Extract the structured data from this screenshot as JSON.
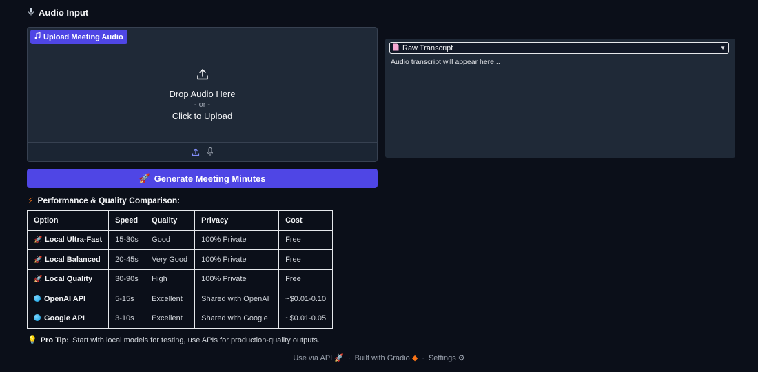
{
  "header": {
    "title": "Audio Input",
    "icon": "microphone-icon"
  },
  "upload": {
    "label": "Upload Meeting Audio",
    "label_icon": "music-note-icon",
    "drop_text": "Drop Audio Here",
    "or_text": "- or -",
    "click_text": "Click to Upload",
    "sources": [
      "upload-icon",
      "microphone-icon"
    ]
  },
  "generate_button": {
    "label": "Generate Meeting Minutes",
    "icon": "rocket-icon"
  },
  "comparison": {
    "heading": "Performance & Quality Comparison:",
    "heading_icon": "lightning-icon",
    "columns": [
      "Option",
      "Speed",
      "Quality",
      "Privacy",
      "Cost"
    ],
    "rows": [
      {
        "icon": "rocket-icon",
        "option": "Local Ultra-Fast",
        "speed": "15-30s",
        "quality": "Good",
        "privacy": "100% Private",
        "cost": "Free"
      },
      {
        "icon": "rocket-icon",
        "option": "Local Balanced",
        "speed": "20-45s",
        "quality": "Very Good",
        "privacy": "100% Private",
        "cost": "Free"
      },
      {
        "icon": "rocket-icon",
        "option": "Local Quality",
        "speed": "30-90s",
        "quality": "High",
        "privacy": "100% Private",
        "cost": "Free"
      },
      {
        "icon": "globe-icon",
        "option": "OpenAI API",
        "speed": "5-15s",
        "quality": "Excellent",
        "privacy": "Shared with OpenAI",
        "cost": "~$0.01-0.10"
      },
      {
        "icon": "globe-icon",
        "option": "Google API",
        "speed": "3-10s",
        "quality": "Excellent",
        "privacy": "Shared with Google",
        "cost": "~$0.01-0.05"
      }
    ]
  },
  "pro_tip": {
    "label": "Pro Tip:",
    "text": "Start with local models for testing, use APIs for production-quality outputs."
  },
  "transcript": {
    "selected": "Raw Transcript",
    "placeholder": "Audio transcript will appear here..."
  },
  "footer": {
    "api_link": "Use via API",
    "built_with": "Built with Gradio",
    "settings": "Settings"
  },
  "colors": {
    "accent": "#4f46e5",
    "background": "#0b0f19",
    "panel": "#1f2937"
  }
}
